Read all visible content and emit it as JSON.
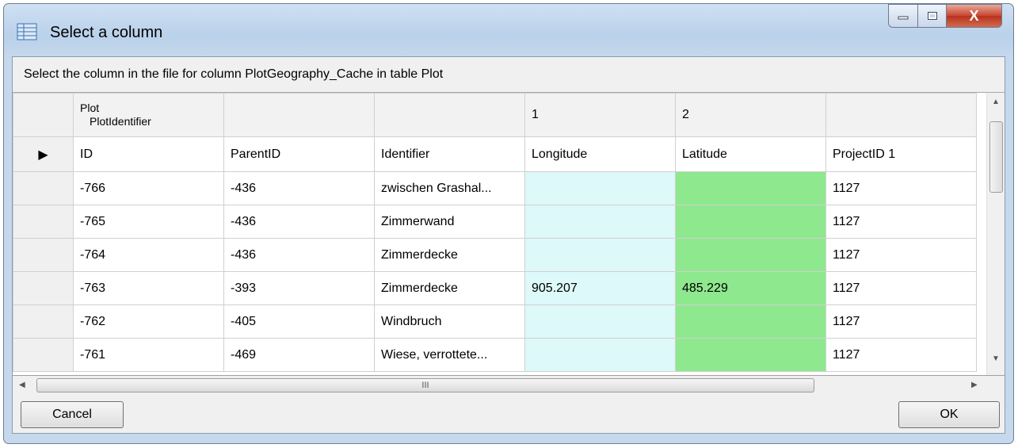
{
  "window": {
    "title": "Select a column",
    "controls": {
      "minimize": "–",
      "maximize": "□",
      "close": "X"
    }
  },
  "instruction": "Select the column in the file for column PlotGeography_Cache in table Plot",
  "grid": {
    "mapping_row": [
      "Plot",
      "PlotIdentifier",
      "",
      "",
      "1",
      "2",
      ""
    ],
    "current_row_indicator": "▶",
    "columns": [
      "ID",
      "ParentID",
      "Identifier",
      "Longitude",
      "Latitude",
      "ProjectID 1"
    ],
    "rows": [
      [
        "-766",
        "-436",
        "zwischen Grashal...",
        "",
        "",
        "1127"
      ],
      [
        "-765",
        "-436",
        "Zimmerwand",
        "",
        "",
        "1127"
      ],
      [
        "-764",
        "-436",
        "Zimmerdecke",
        "",
        "",
        "1127"
      ],
      [
        "-763",
        "-393",
        "Zimmerdecke",
        "905.207",
        "485.229",
        "1127"
      ],
      [
        "-762",
        "-405",
        "Windbruch",
        "",
        "",
        "1127"
      ],
      [
        "-761",
        "-469",
        "Wiese, verrottete...",
        "",
        "",
        "1127"
      ]
    ],
    "colors": {
      "longitude_bg": "#ddf9f9",
      "latitude_bg": "#8ee88e"
    }
  },
  "scrollbar": {
    "hthumb_grip": "III"
  },
  "buttons": {
    "cancel": "Cancel",
    "ok": "OK"
  }
}
